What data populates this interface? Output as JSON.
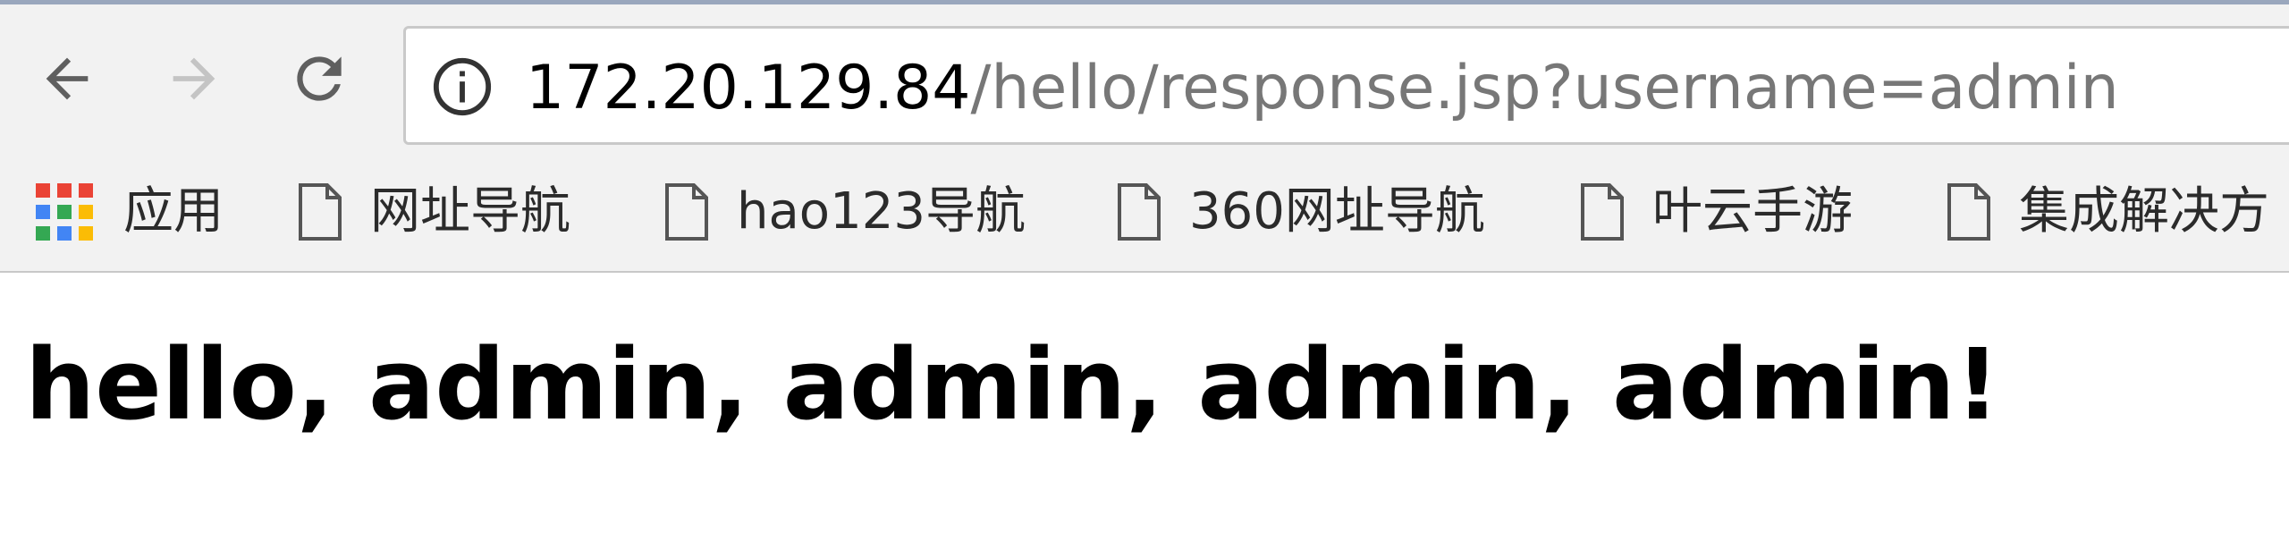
{
  "toolbar": {
    "back_icon": "arrow-left-icon",
    "forward_icon": "arrow-right-icon",
    "reload_icon": "reload-icon",
    "info_icon": "info-icon",
    "url_host": "172.20.129.84",
    "url_path": "/hello/response.jsp?username=admin"
  },
  "bookmarks": {
    "apps_label": "应用",
    "items": [
      {
        "label": "网址导航"
      },
      {
        "label": "hao123导航"
      },
      {
        "label": "360网址导航"
      },
      {
        "label": "叶云手游"
      },
      {
        "label": "集成解决方"
      }
    ]
  },
  "content": {
    "greeting": "hello, admin, admin, admin, admin!"
  },
  "colors": {
    "toolbar_bg": "#f2f2f2",
    "url_host": "#000000",
    "url_path": "#777777",
    "forward_disabled": "#c4c4c4"
  }
}
